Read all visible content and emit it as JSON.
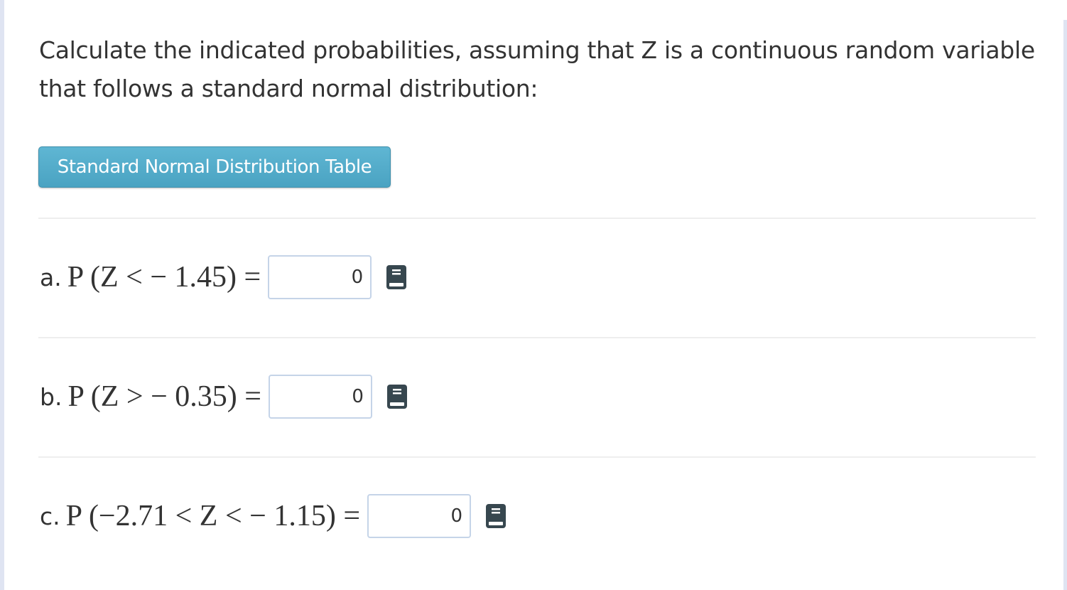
{
  "prompt": {
    "line1": "Calculate the indicated probabilities, assuming that Z is a continuous random variable",
    "line2": "that follows a standard normal distribution:"
  },
  "table_button": {
    "label": "Standard Normal Distribution Table"
  },
  "questions": [
    {
      "letter": "a.",
      "expression": "P (Z <  − 1.45) =",
      "value": "0",
      "icon": "book-icon"
    },
    {
      "letter": "b.",
      "expression": "P (Z >  − 0.35) =",
      "value": "0",
      "icon": "book-icon"
    },
    {
      "letter": "c.",
      "expression": "P (−2.71 < Z <  − 1.15) =",
      "value": "0",
      "icon": "book-icon"
    }
  ],
  "colors": {
    "button": "#4aa3c2",
    "input_border": "#c5d4e8",
    "icon": "#37474f"
  }
}
